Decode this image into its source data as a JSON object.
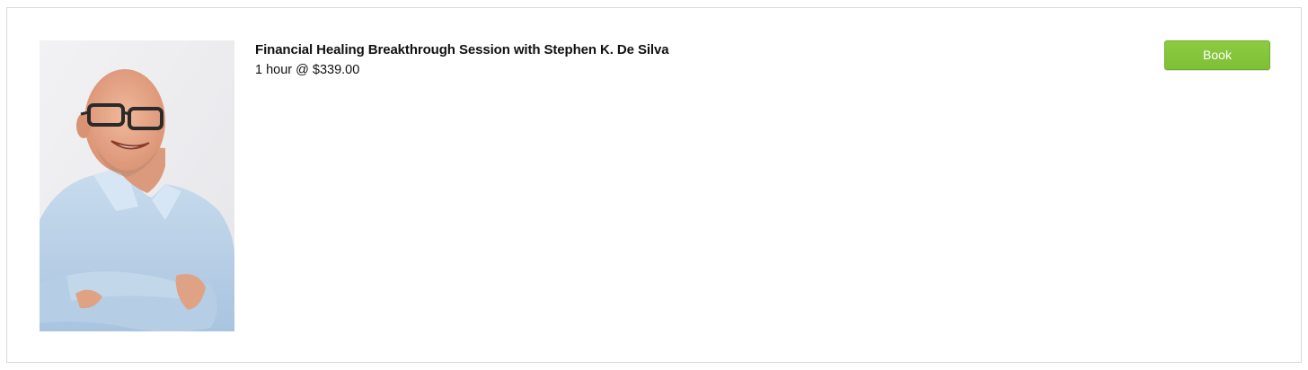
{
  "service": {
    "title": "Financial Healing Breakthrough Session with Stephen K. De Silva",
    "duration_price": "1 hour @ $339.00",
    "photo_alt": "Stephen K. De Silva portrait"
  },
  "actions": {
    "book_label": "Book"
  },
  "colors": {
    "book_button": "#84c43b",
    "card_border": "#d9d9d9"
  }
}
